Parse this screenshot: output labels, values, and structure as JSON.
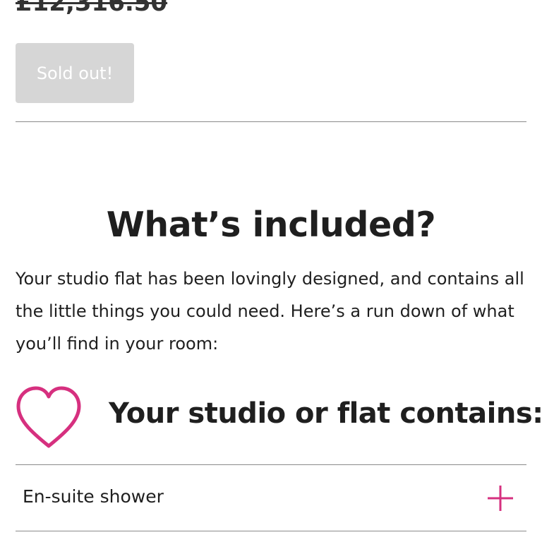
{
  "pricing": {
    "old_price": "£12,316.50"
  },
  "buy": {
    "sold_out_label": "Sold out!"
  },
  "included": {
    "title": "What’s included?",
    "description": "Your studio flat has been lovingly designed, and contains all the little things you could need. Here’s a run down of what you’ll find in your room:",
    "contains_heading": "Your studio or flat contains:",
    "items": [
      {
        "label": "En-suite shower",
        "icon": "plus-icon"
      }
    ]
  },
  "colors": {
    "accent": "#d6307f",
    "button_disabled": "#d6d6d6",
    "divider": "#8a8a8a"
  }
}
